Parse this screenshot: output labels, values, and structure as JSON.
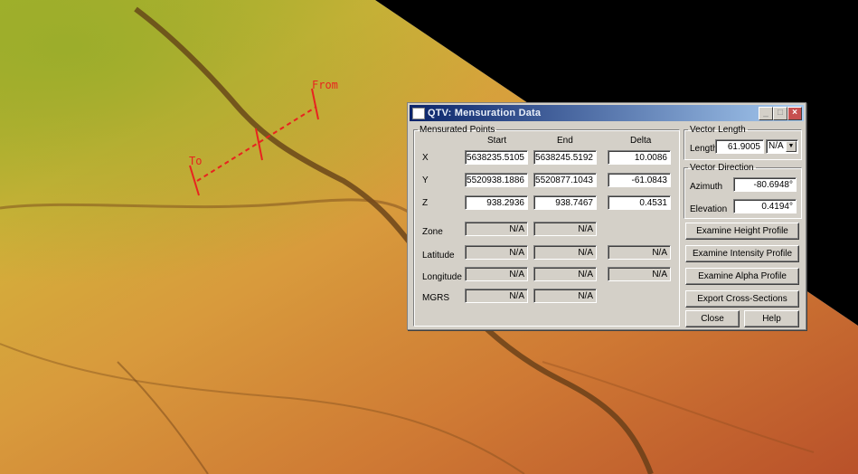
{
  "markers": {
    "from_label": "From",
    "to_label": "To",
    "line_color": "#e8231f"
  },
  "dialog": {
    "title": "QTV: Mensuration Data",
    "window_buttons": {
      "minimize": "_",
      "maximize": "□",
      "close": "×"
    },
    "points_group": {
      "legend": "Mensurated Points",
      "columns": {
        "start": "Start",
        "end": "End",
        "delta": "Delta"
      },
      "rows": {
        "x": {
          "label": "X",
          "start": "5638235.5105",
          "end": "5638245.5192",
          "delta": "10.0086"
        },
        "y": {
          "label": "Y",
          "start": "5520938.1886",
          "end": "5520877.1043",
          "delta": "-61.0843"
        },
        "z": {
          "label": "Z",
          "start": "938.2936",
          "end": "938.7467",
          "delta": "0.4531"
        },
        "zone": {
          "label": "Zone",
          "start": "N/A",
          "end": "N/A"
        },
        "latitude": {
          "label": "Latitude",
          "start": "N/A",
          "end": "N/A",
          "delta": "N/A"
        },
        "longitude": {
          "label": "Longitude",
          "start": "N/A",
          "end": "N/A",
          "delta": "N/A"
        },
        "mgrs": {
          "label": "MGRS",
          "start": "N/A",
          "end": "N/A"
        }
      }
    },
    "vector_length": {
      "legend": "Vector Length",
      "label": "Length",
      "value": "61.9005",
      "unit": "N/A"
    },
    "vector_direction": {
      "legend": "Vector Direction",
      "azimuth_label": "Azimuth",
      "azimuth": "-80.6948°",
      "elevation_label": "Elevation",
      "elevation": "0.4194°"
    },
    "buttons": {
      "height_profile": "Examine Height Profile",
      "intensity_profile": "Examine Intensity Profile",
      "alpha_profile": "Examine Alpha Profile",
      "export": "Export Cross-Sections",
      "close": "Close",
      "help": "Help"
    }
  }
}
